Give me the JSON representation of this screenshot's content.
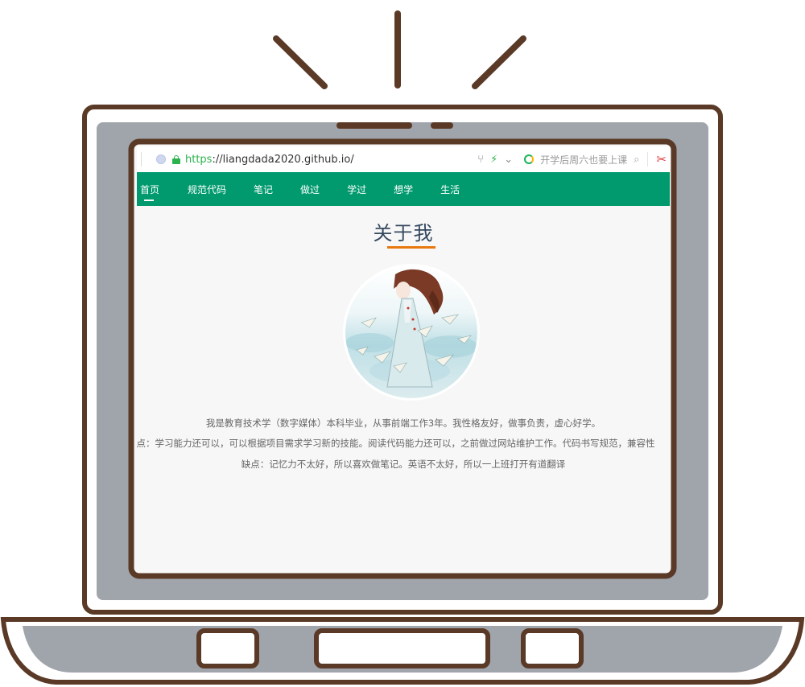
{
  "browser": {
    "url_scheme": "https",
    "url_rest": "://liangdada2020.github.io/",
    "search_hint": "开学后周六也要上课",
    "icons": [
      "site-icon",
      "lock-icon",
      "share-icon",
      "bolt-icon",
      "chevron-down-icon",
      "search-engine-icon",
      "search-icon",
      "scissors-icon"
    ]
  },
  "nav": {
    "items": [
      {
        "label": "首页",
        "active": true
      },
      {
        "label": "规范代码"
      },
      {
        "label": "笔记"
      },
      {
        "label": "做过"
      },
      {
        "label": "学过"
      },
      {
        "label": "想学"
      },
      {
        "label": "生活"
      }
    ]
  },
  "about": {
    "title": "关于我",
    "p1": "我是教育技术学（数字媒体）本科毕业，从事前端工作3年。我性格友好，做事负责，虚心好学。",
    "p2": "优点：学习能力还可以，可以根据项目需求学习新的技能。阅读代码能力还可以，之前做过网站维护工作。代码书写规范，兼容性",
    "p3": "缺点：记忆力不太好，所以喜欢做笔记。英语不太好，所以一上班打开有道翻译"
  },
  "colors": {
    "outline": "#5a3a26",
    "bezel": "#a0a4ab",
    "nav": "#009a6e",
    "accent": "#e8780f",
    "url_green": "#2bb24c"
  }
}
